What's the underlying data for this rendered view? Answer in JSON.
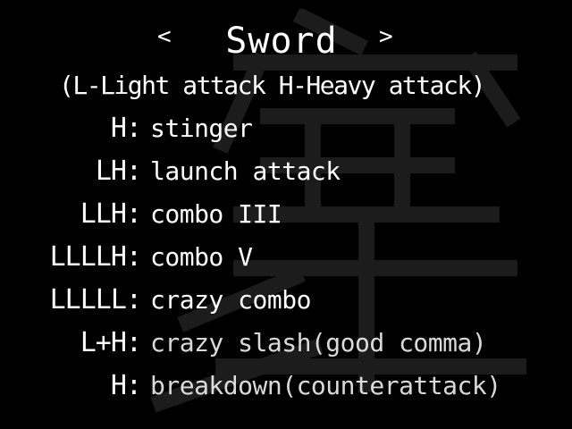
{
  "screen": {
    "prev_arrow": "<",
    "next_arrow": ">",
    "weapon": "Sword",
    "legend": "(L-Light attack  H-Heavy attack)",
    "watermark_icon": "kanji-watermark-icon"
  },
  "moves": [
    {
      "input": "H:",
      "name": "stinger"
    },
    {
      "input": "LH:",
      "name": "launch attack"
    },
    {
      "input": "LLH:",
      "name": "combo III"
    },
    {
      "input": "LLLLH:",
      "name": "combo V"
    },
    {
      "input": "LLLLL:",
      "name": "crazy combo"
    },
    {
      "input": "L+H:",
      "name": "crazy slash(good comma)"
    },
    {
      "input": "H:",
      "name": "breakdown(counterattack)"
    }
  ]
}
